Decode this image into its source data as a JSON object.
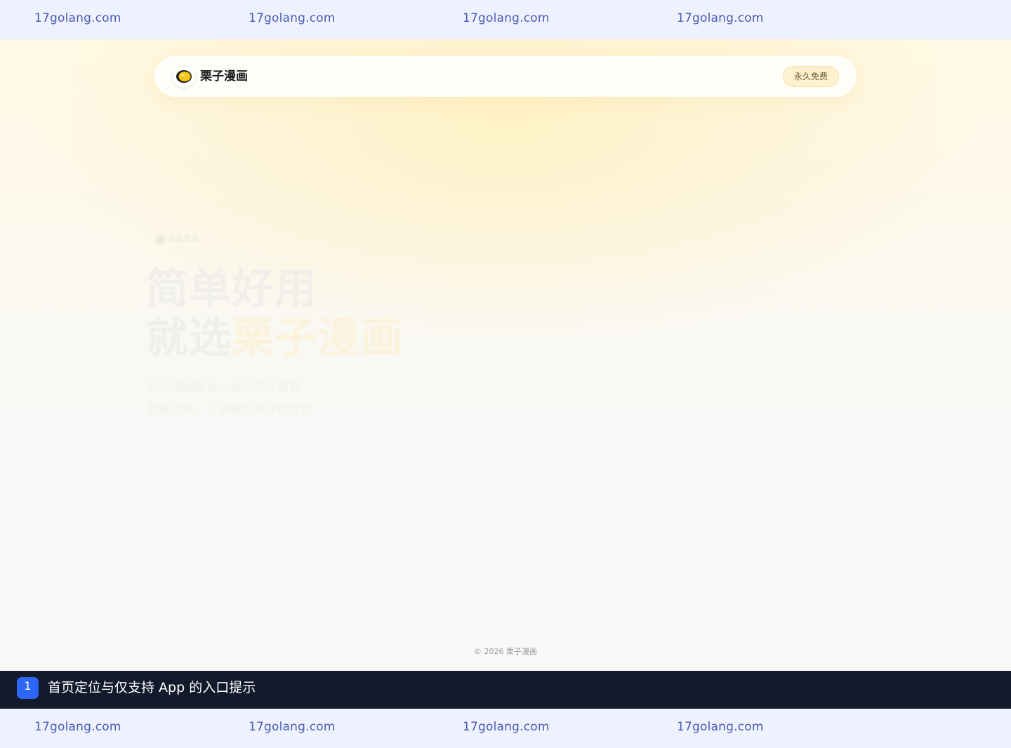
{
  "watermark": {
    "top": [
      "17golang.com",
      "17golang.com",
      "17golang.com",
      "17golang.com"
    ],
    "bottom": [
      "17golang.com",
      "17golang.com",
      "17golang.com",
      "17golang.com"
    ]
  },
  "navbar": {
    "brand": "栗子漫画",
    "badge": "永久免费"
  },
  "hero": {
    "tag": "漫画阅读",
    "title_line1": "简单好用",
    "title_line2_prefix": "就选",
    "title_line2_accent": "栗子漫画",
    "desc_line1": "全网漫画聚合，每日同步更新",
    "desc_line2": "海量资源，让漫画的美好陪伴你"
  },
  "footer": {
    "copyright": "© 2026 栗子漫画"
  },
  "caption": {
    "number": "1",
    "text": "首页定位与仅支持 App 的入口提示"
  },
  "colors": {
    "watermark_text": "#4a5bb8",
    "caption_bg": "#121a2c",
    "caption_badge": "#2b66f6",
    "logo_yellow": "#f5c518",
    "badge_bg": "#fdf1cf"
  },
  "icons": {
    "logo": "chestnut-logo-icon"
  }
}
